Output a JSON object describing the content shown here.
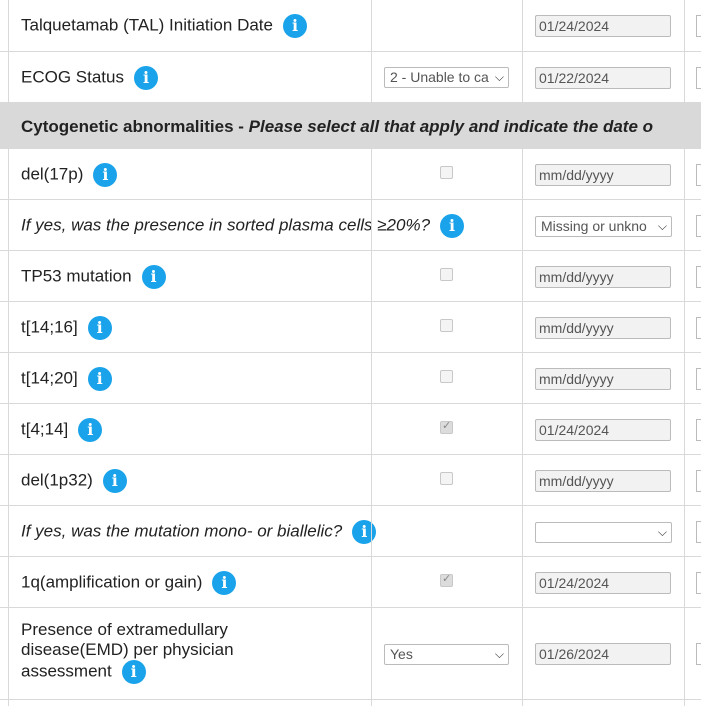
{
  "rows": [
    {
      "label": "Talquetamab (TAL) Initiation Date",
      "date": "01/24/2024"
    },
    {
      "label": "ECOG Status",
      "select": "2 - Unable to ca",
      "date": "01/22/2024"
    },
    {
      "header_bold": "Cytogenetic abnormalities - ",
      "header_italic": "Please select all that apply and indicate the date o"
    },
    {
      "label": "del(17p)",
      "date": "mm/dd/yyyy"
    },
    {
      "label": "If yes, was the presence in sorted plasma cells ≥20%?",
      "select": "Missing or unkno"
    },
    {
      "label": "TP53 mutation",
      "date": "mm/dd/yyyy"
    },
    {
      "label": "t[14;16]",
      "date": "mm/dd/yyyy"
    },
    {
      "label": "t[14;20]",
      "date": "mm/dd/yyyy"
    },
    {
      "label": "t[4;14]",
      "date": "01/24/2024"
    },
    {
      "label": "del(1p32)",
      "date": "mm/dd/yyyy"
    },
    {
      "label": "If yes, was the mutation mono- or biallelic?",
      "select": ""
    },
    {
      "label": "1q(amplification or gain)",
      "date": "01/24/2024"
    },
    {
      "label_l1": "Presence of extramedullary",
      "label_l2": "disease(EMD) per physician",
      "label_l3": "assessment",
      "select": "Yes",
      "date": "01/26/2024"
    }
  ],
  "info_icon_glyph": "i",
  "colors": {
    "info": "#1aa3ea",
    "header_bg": "#d9d9d9",
    "border": "#d9d9d9"
  }
}
